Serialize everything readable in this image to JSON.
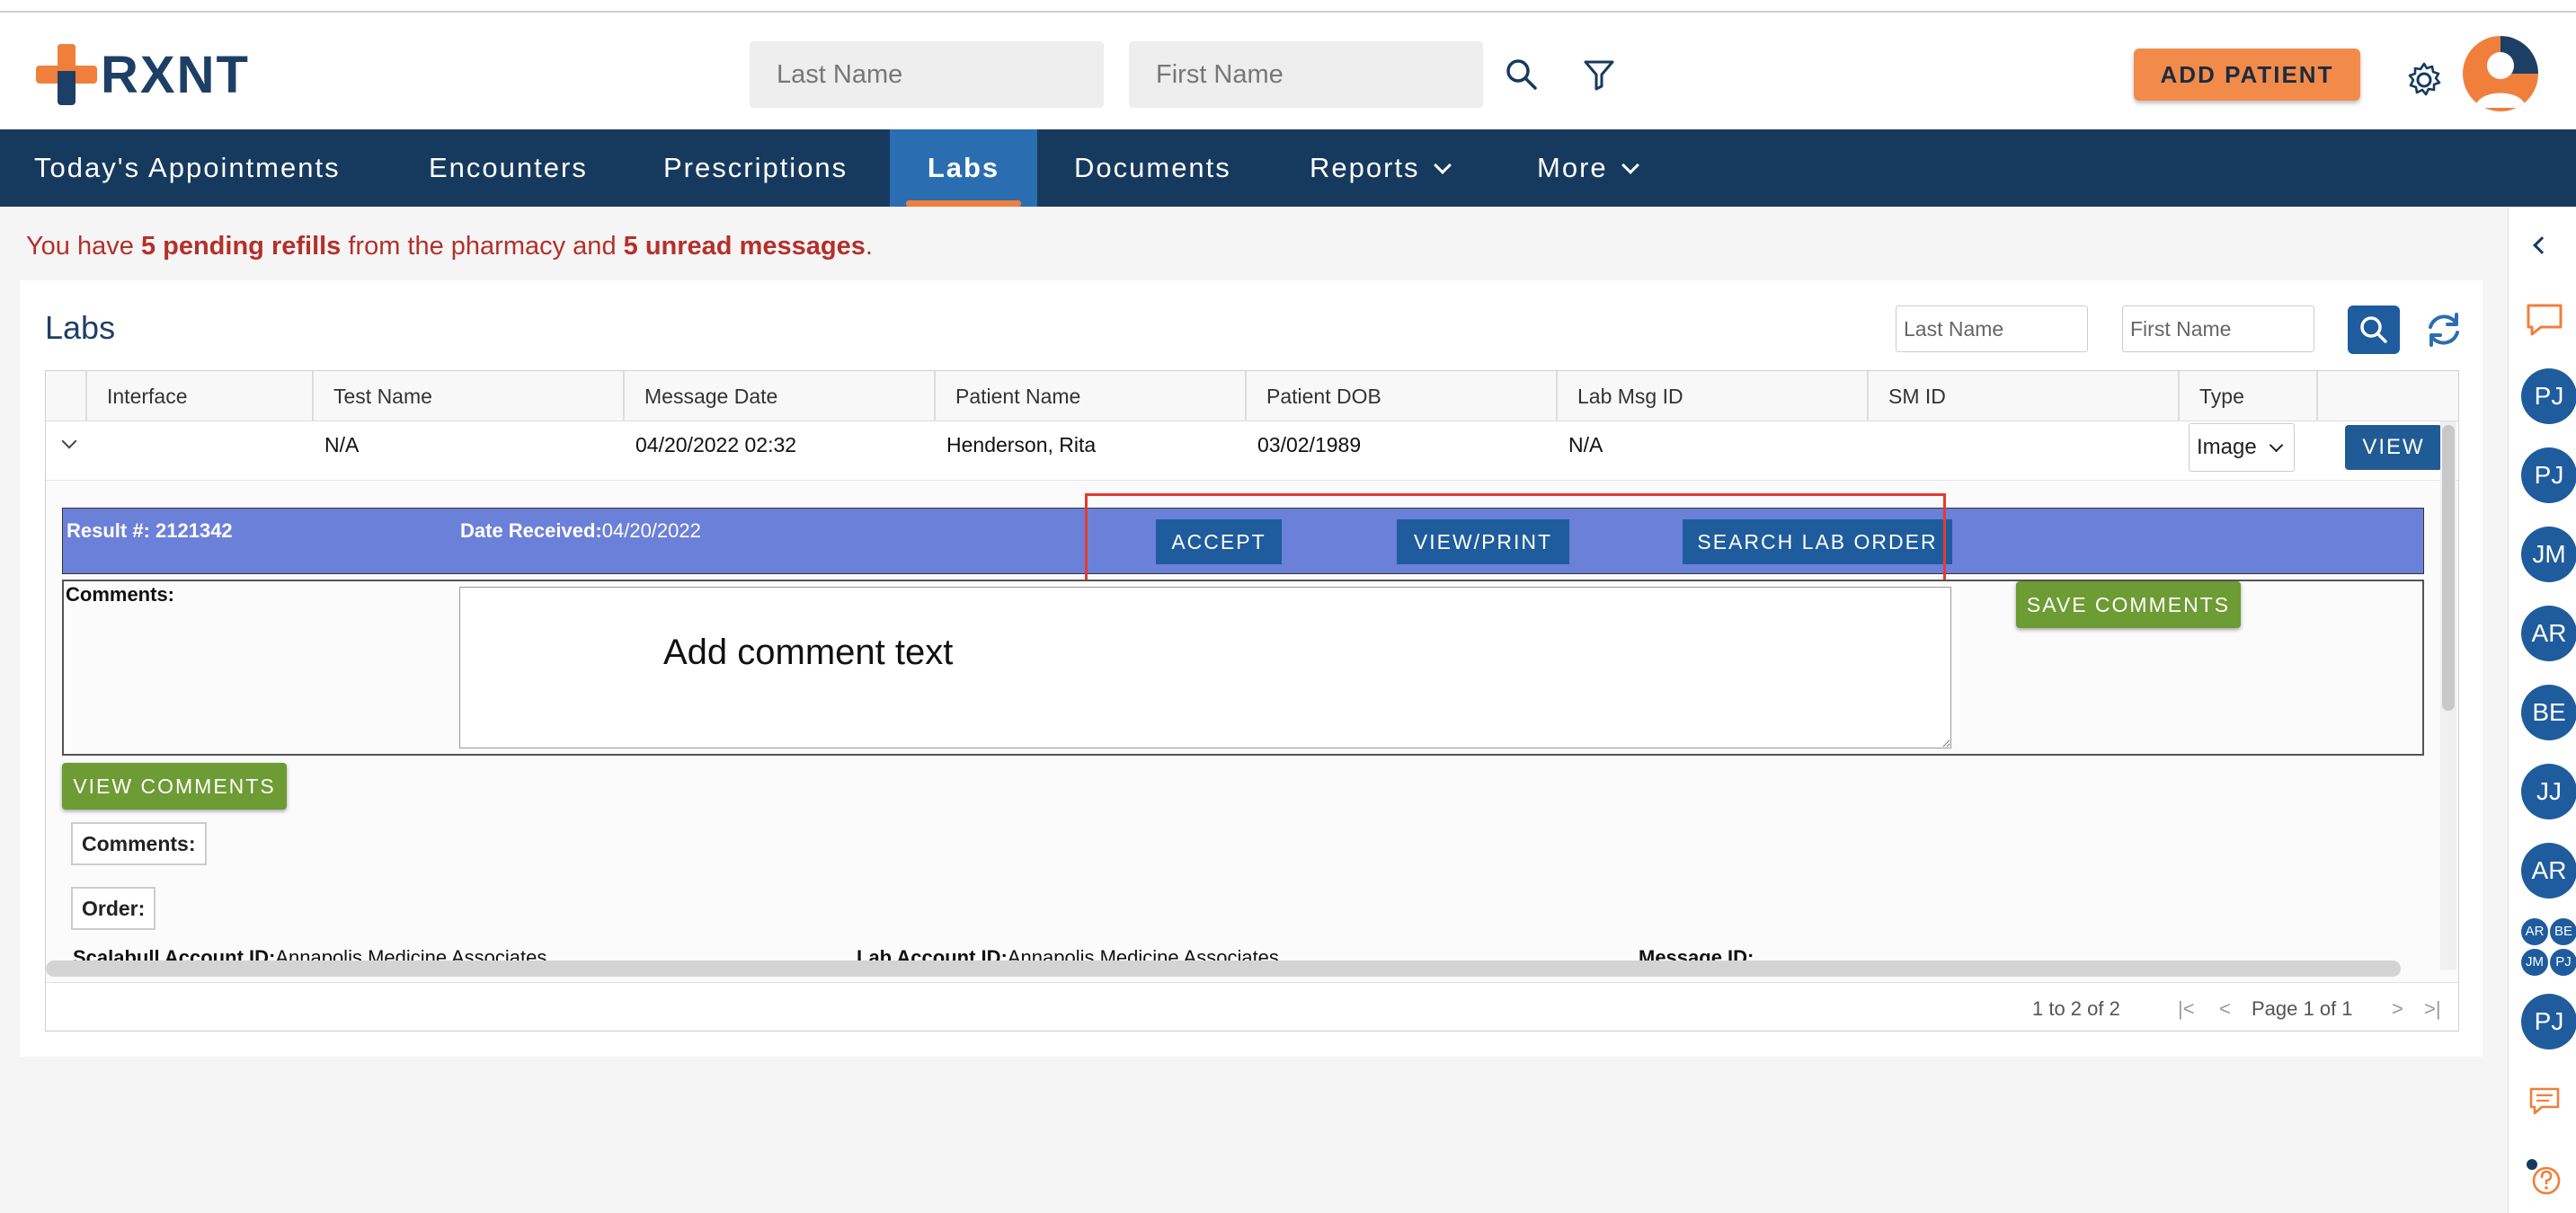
{
  "header": {
    "logo_text": "RXNT",
    "last_name_placeholder": "Last Name",
    "first_name_placeholder": "First Name",
    "add_patient_label": "ADD PATIENT"
  },
  "nav": {
    "items": [
      {
        "label": "Today's Appointments"
      },
      {
        "label": "Encounters"
      },
      {
        "label": "Prescriptions"
      },
      {
        "label": "Labs",
        "active": true
      },
      {
        "label": "Documents"
      },
      {
        "label": "Reports",
        "dropdown": true
      },
      {
        "label": "More",
        "dropdown": true
      }
    ]
  },
  "alert": {
    "prefix": "You have ",
    "refills": "5 pending refills",
    "middle": " from the pharmacy and ",
    "messages": "5 unread messages",
    "suffix": "."
  },
  "labs": {
    "title": "Labs",
    "last_name_placeholder": "Last Name",
    "first_name_placeholder": "First Name",
    "columns": [
      "Interface",
      "Test Name",
      "Message Date",
      "Patient Name",
      "Patient DOB",
      "Lab Msg ID",
      "SM ID",
      "Type"
    ],
    "row": {
      "interface": "",
      "test_name": "N/A",
      "message_date": "04/20/2022 02:32",
      "patient_name": "Henderson, Rita",
      "patient_dob": "03/02/1989",
      "lab_msg_id": "N/A",
      "sm_id": "",
      "type": "Image",
      "view_label": "VIEW"
    },
    "result": {
      "result_label": "Result #: 2121342",
      "date_label": "Date Received:",
      "date_value": "04/20/2022",
      "accept_label": "ACCEPT",
      "view_print_label": "VIEW/PRINT",
      "search_lab_order_label": "SEARCH LAB ORDER"
    },
    "comments": {
      "label": "Comments:",
      "text": "Add comment text",
      "save_label": "SAVE COMMENTS",
      "view_label": "VIEW COMMENTS",
      "comments_tag": "Comments:",
      "order_tag": "Order:"
    },
    "accounts": {
      "scalabull_label": "Scalabull Account ID:",
      "scalabull_value": "Annapolis Medicine Associates",
      "lab_label": "Lab Account ID:",
      "lab_value": "Annapolis Medicine Associates",
      "message_label": "Message ID:"
    },
    "pager": {
      "range": "1 to 2 of 2",
      "page": "Page 1 of 1"
    }
  },
  "rail": {
    "avatars": [
      "PJ",
      "PJ",
      "JM",
      "AR",
      "BE",
      "JJ",
      "AR"
    ],
    "mini_avatars": [
      "AR",
      "BE",
      "JM",
      "PJ"
    ],
    "last_avatar": "PJ"
  },
  "colors": {
    "navy": "#163a5e",
    "accent_orange": "#f07f3c",
    "active_tab": "#2a6db0",
    "result_bar": "#6b80d9",
    "green_button": "#6d9b34",
    "alert_red": "#b5302a"
  }
}
